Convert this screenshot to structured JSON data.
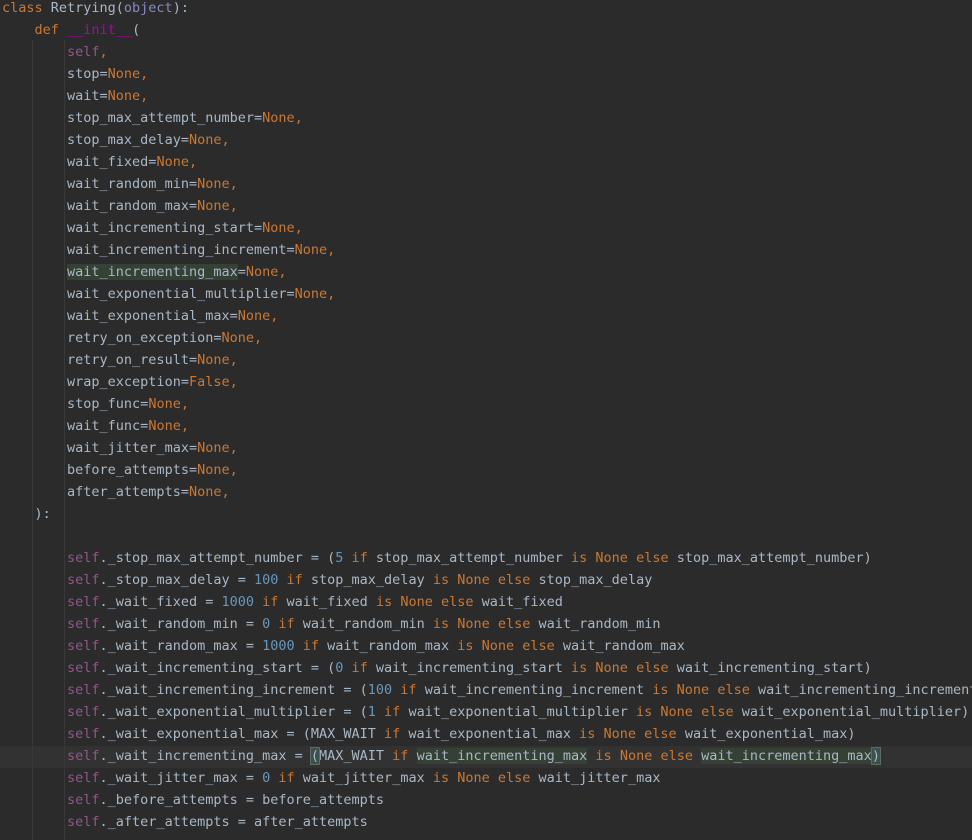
{
  "editor": {
    "colors": {
      "background": "#2b2b2b",
      "text": "#a9b7c6",
      "keyword": "#cc7832",
      "self": "#94558d",
      "dunder": "#b200b2",
      "builtin": "#8888c6",
      "number": "#6897bb",
      "usage_highlight": "#344134",
      "current_line": "#323232"
    },
    "current_line_index": 34,
    "lines": [
      {
        "indent": 0,
        "tokens": [
          {
            "t": "class",
            "k": "kw"
          },
          {
            "t": " Retrying("
          },
          {
            "t": "object",
            "k": "builtin"
          },
          {
            "t": "):"
          }
        ]
      },
      {
        "indent": 1,
        "tokens": [
          {
            "t": "def",
            "k": "kw"
          },
          {
            "t": " "
          },
          {
            "t": "__init__",
            "k": "magic"
          },
          {
            "t": "("
          }
        ]
      },
      {
        "indent": 2,
        "tokens": [
          {
            "t": "self",
            "k": "self"
          },
          {
            "t": ",",
            "k": "kw"
          }
        ]
      },
      {
        "indent": 2,
        "tokens": [
          {
            "t": "stop="
          },
          {
            "t": "None,",
            "k": "kw"
          }
        ]
      },
      {
        "indent": 2,
        "tokens": [
          {
            "t": "wait="
          },
          {
            "t": "None,",
            "k": "kw"
          }
        ]
      },
      {
        "indent": 2,
        "tokens": [
          {
            "t": "stop_max_attempt_number="
          },
          {
            "t": "None,",
            "k": "kw"
          }
        ]
      },
      {
        "indent": 2,
        "tokens": [
          {
            "t": "stop_max_delay="
          },
          {
            "t": "None,",
            "k": "kw"
          }
        ]
      },
      {
        "indent": 2,
        "tokens": [
          {
            "t": "wait_fixed="
          },
          {
            "t": "None,",
            "k": "kw"
          }
        ]
      },
      {
        "indent": 2,
        "tokens": [
          {
            "t": "wait_random_min="
          },
          {
            "t": "None,",
            "k": "kw"
          }
        ]
      },
      {
        "indent": 2,
        "tokens": [
          {
            "t": "wait_random_max="
          },
          {
            "t": "None,",
            "k": "kw"
          }
        ]
      },
      {
        "indent": 2,
        "tokens": [
          {
            "t": "wait_incrementing_start="
          },
          {
            "t": "None,",
            "k": "kw"
          }
        ]
      },
      {
        "indent": 2,
        "tokens": [
          {
            "t": "wait_incrementing_increment="
          },
          {
            "t": "None,",
            "k": "kw"
          }
        ]
      },
      {
        "indent": 2,
        "tokens": [
          {
            "t": "wait_incrementing_max",
            "k": "usage"
          },
          {
            "t": "="
          },
          {
            "t": "None,",
            "k": "kw"
          }
        ]
      },
      {
        "indent": 2,
        "tokens": [
          {
            "t": "wait_exponential_multiplier="
          },
          {
            "t": "None,",
            "k": "kw"
          }
        ]
      },
      {
        "indent": 2,
        "tokens": [
          {
            "t": "wait_exponential_max="
          },
          {
            "t": "None,",
            "k": "kw"
          }
        ]
      },
      {
        "indent": 2,
        "tokens": [
          {
            "t": "retry_on_exception="
          },
          {
            "t": "None,",
            "k": "kw"
          }
        ]
      },
      {
        "indent": 2,
        "tokens": [
          {
            "t": "retry_on_result="
          },
          {
            "t": "None,",
            "k": "kw"
          }
        ]
      },
      {
        "indent": 2,
        "tokens": [
          {
            "t": "wrap_exception="
          },
          {
            "t": "False,",
            "k": "kw"
          }
        ]
      },
      {
        "indent": 2,
        "tokens": [
          {
            "t": "stop_func="
          },
          {
            "t": "None,",
            "k": "kw"
          }
        ]
      },
      {
        "indent": 2,
        "tokens": [
          {
            "t": "wait_func="
          },
          {
            "t": "None,",
            "k": "kw"
          }
        ]
      },
      {
        "indent": 2,
        "tokens": [
          {
            "t": "wait_jitter_max="
          },
          {
            "t": "None,",
            "k": "kw"
          }
        ]
      },
      {
        "indent": 2,
        "tokens": [
          {
            "t": "before_attempts="
          },
          {
            "t": "None,",
            "k": "kw"
          }
        ]
      },
      {
        "indent": 2,
        "tokens": [
          {
            "t": "after_attempts="
          },
          {
            "t": "None,",
            "k": "kw"
          }
        ]
      },
      {
        "indent": 1,
        "tokens": [
          {
            "t": "):"
          }
        ]
      },
      {
        "indent": 0,
        "tokens": []
      },
      {
        "indent": 2,
        "tokens": [
          {
            "t": "self",
            "k": "self"
          },
          {
            "t": "._stop_max_attempt_number = ("
          },
          {
            "t": "5",
            "k": "num"
          },
          {
            "t": " "
          },
          {
            "t": "if",
            "k": "kw"
          },
          {
            "t": " stop_max_attempt_number "
          },
          {
            "t": "is",
            "k": "kw"
          },
          {
            "t": " "
          },
          {
            "t": "None",
            "k": "kw"
          },
          {
            "t": " "
          },
          {
            "t": "else",
            "k": "kw"
          },
          {
            "t": " stop_max_attempt_number)"
          }
        ]
      },
      {
        "indent": 2,
        "tokens": [
          {
            "t": "self",
            "k": "self"
          },
          {
            "t": "._stop_max_delay = "
          },
          {
            "t": "100",
            "k": "num"
          },
          {
            "t": " "
          },
          {
            "t": "if",
            "k": "kw"
          },
          {
            "t": " stop_max_delay "
          },
          {
            "t": "is",
            "k": "kw"
          },
          {
            "t": " "
          },
          {
            "t": "None",
            "k": "kw"
          },
          {
            "t": " "
          },
          {
            "t": "else",
            "k": "kw"
          },
          {
            "t": " stop_max_delay"
          }
        ]
      },
      {
        "indent": 2,
        "tokens": [
          {
            "t": "self",
            "k": "self"
          },
          {
            "t": "._wait_fixed = "
          },
          {
            "t": "1000",
            "k": "num"
          },
          {
            "t": " "
          },
          {
            "t": "if",
            "k": "kw"
          },
          {
            "t": " wait_fixed "
          },
          {
            "t": "is",
            "k": "kw"
          },
          {
            "t": " "
          },
          {
            "t": "None",
            "k": "kw"
          },
          {
            "t": " "
          },
          {
            "t": "else",
            "k": "kw"
          },
          {
            "t": " wait_fixed"
          }
        ]
      },
      {
        "indent": 2,
        "tokens": [
          {
            "t": "self",
            "k": "self"
          },
          {
            "t": "._wait_random_min = "
          },
          {
            "t": "0",
            "k": "num"
          },
          {
            "t": " "
          },
          {
            "t": "if",
            "k": "kw"
          },
          {
            "t": " wait_random_min "
          },
          {
            "t": "is",
            "k": "kw"
          },
          {
            "t": " "
          },
          {
            "t": "None",
            "k": "kw"
          },
          {
            "t": " "
          },
          {
            "t": "else",
            "k": "kw"
          },
          {
            "t": " wait_random_min"
          }
        ]
      },
      {
        "indent": 2,
        "tokens": [
          {
            "t": "self",
            "k": "self"
          },
          {
            "t": "._wait_random_max = "
          },
          {
            "t": "1000",
            "k": "num"
          },
          {
            "t": " "
          },
          {
            "t": "if",
            "k": "kw"
          },
          {
            "t": " wait_random_max "
          },
          {
            "t": "is",
            "k": "kw"
          },
          {
            "t": " "
          },
          {
            "t": "None",
            "k": "kw"
          },
          {
            "t": " "
          },
          {
            "t": "else",
            "k": "kw"
          },
          {
            "t": " wait_random_max"
          }
        ]
      },
      {
        "indent": 2,
        "tokens": [
          {
            "t": "self",
            "k": "self"
          },
          {
            "t": "._wait_incrementing_start = ("
          },
          {
            "t": "0",
            "k": "num"
          },
          {
            "t": " "
          },
          {
            "t": "if",
            "k": "kw"
          },
          {
            "t": " wait_incrementing_start "
          },
          {
            "t": "is",
            "k": "kw"
          },
          {
            "t": " "
          },
          {
            "t": "None",
            "k": "kw"
          },
          {
            "t": " "
          },
          {
            "t": "else",
            "k": "kw"
          },
          {
            "t": " wait_incrementing_start)"
          }
        ]
      },
      {
        "indent": 2,
        "tokens": [
          {
            "t": "self",
            "k": "self"
          },
          {
            "t": "._wait_incrementing_increment = ("
          },
          {
            "t": "100",
            "k": "num"
          },
          {
            "t": " "
          },
          {
            "t": "if",
            "k": "kw"
          },
          {
            "t": " wait_incrementing_increment "
          },
          {
            "t": "is",
            "k": "kw"
          },
          {
            "t": " "
          },
          {
            "t": "None",
            "k": "kw"
          },
          {
            "t": " "
          },
          {
            "t": "else",
            "k": "kw"
          },
          {
            "t": " wait_incrementing_increment)"
          }
        ]
      },
      {
        "indent": 2,
        "tokens": [
          {
            "t": "self",
            "k": "self"
          },
          {
            "t": "._wait_exponential_multiplier = ("
          },
          {
            "t": "1",
            "k": "num"
          },
          {
            "t": " "
          },
          {
            "t": "if",
            "k": "kw"
          },
          {
            "t": " wait_exponential_multiplier "
          },
          {
            "t": "is",
            "k": "kw"
          },
          {
            "t": " "
          },
          {
            "t": "None",
            "k": "kw"
          },
          {
            "t": " "
          },
          {
            "t": "else",
            "k": "kw"
          },
          {
            "t": " wait_exponential_multiplier)"
          }
        ]
      },
      {
        "indent": 2,
        "tokens": [
          {
            "t": "self",
            "k": "self"
          },
          {
            "t": "._wait_exponential_max = (MAX_WAIT "
          },
          {
            "t": "if",
            "k": "kw"
          },
          {
            "t": " wait_exponential_max "
          },
          {
            "t": "is",
            "k": "kw"
          },
          {
            "t": " "
          },
          {
            "t": "None",
            "k": "kw"
          },
          {
            "t": " "
          },
          {
            "t": "else",
            "k": "kw"
          },
          {
            "t": " wait_exponential_max)"
          }
        ]
      },
      {
        "indent": 2,
        "tokens": [
          {
            "t": "self",
            "k": "self"
          },
          {
            "t": "._wait_incrementing_max = "
          },
          {
            "t": "(",
            "k": "brace"
          },
          {
            "t": "MAX_WAIT "
          },
          {
            "t": "if",
            "k": "kw"
          },
          {
            "t": " "
          },
          {
            "t": "wait_incrementing_max",
            "k": "usage"
          },
          {
            "t": " "
          },
          {
            "t": "is",
            "k": "kw"
          },
          {
            "t": " "
          },
          {
            "t": "None",
            "k": "kw"
          },
          {
            "t": " "
          },
          {
            "t": "else",
            "k": "kw"
          },
          {
            "t": " "
          },
          {
            "t": "wait_incrementing_max",
            "k": "usage"
          },
          {
            "t": "",
            "k": "caret"
          },
          {
            "t": ")",
            "k": "brace"
          }
        ]
      },
      {
        "indent": 2,
        "tokens": [
          {
            "t": "self",
            "k": "self"
          },
          {
            "t": "._wait_jitter_max = "
          },
          {
            "t": "0",
            "k": "num"
          },
          {
            "t": " "
          },
          {
            "t": "if",
            "k": "kw"
          },
          {
            "t": " wait_jitter_max "
          },
          {
            "t": "is",
            "k": "kw"
          },
          {
            "t": " "
          },
          {
            "t": "None",
            "k": "kw"
          },
          {
            "t": " "
          },
          {
            "t": "else",
            "k": "kw"
          },
          {
            "t": " wait_jitter_max"
          }
        ]
      },
      {
        "indent": 2,
        "tokens": [
          {
            "t": "self",
            "k": "self"
          },
          {
            "t": "._before_attempts = before_attempts"
          }
        ]
      },
      {
        "indent": 2,
        "tokens": [
          {
            "t": "self",
            "k": "self"
          },
          {
            "t": "._after_attempts = after_attempts"
          }
        ]
      }
    ]
  }
}
